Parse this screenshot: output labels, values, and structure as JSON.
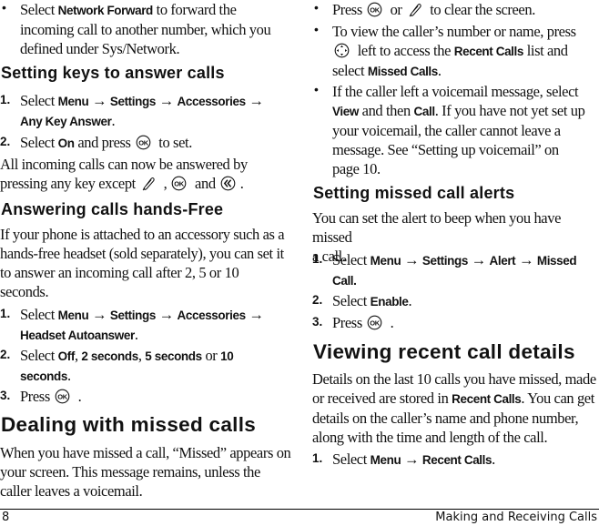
{
  "left": {
    "bullet_network": {
      "pre": "Select ",
      "bold": "Network Forward",
      "post1": " to forward the",
      "line2": "incoming call to another number, which you",
      "line3": "defined under Sys/Network."
    },
    "h_setting_keys": "Setting keys to answer calls",
    "sk_step1": {
      "num": "1.",
      "pre": "Select ",
      "menu": "Menu",
      "arrow": "→",
      "settings": "Settings",
      "accessories": "Accessories",
      "line2": "Any Key Answer",
      "end": "."
    },
    "sk_step2": {
      "num": "2.",
      "pre": "Select ",
      "on": "On",
      "mid": " and press",
      "post": " to set."
    },
    "sk_para": {
      "line1": "All incoming calls can now be answered by",
      "line2_pre": "pressing any key except",
      "comma": " ,",
      "and": " and",
      "end": "."
    },
    "h_hands_free": "Answering calls hands-Free",
    "hf_para": [
      "If your phone is attached to an accessory such as a",
      "hands-free headset (sold separately), you can set it",
      "to answer an incoming call after 2, 5 or 10",
      "seconds."
    ],
    "hf_step1": {
      "num": "1.",
      "pre": "Select ",
      "menu": "Menu",
      "arrow": "→",
      "settings": "Settings",
      "accessories": "Accessories",
      "line2": "Headset Autoanswer",
      "end": "."
    },
    "hf_step2": {
      "num": "2.",
      "pre": "Select ",
      "off": "Off",
      "comma": ", ",
      "two": "2 seconds",
      "five": "5 seconds",
      "or": " or ",
      "ten": "10",
      "line2": "seconds",
      "end": "."
    },
    "hf_step3": {
      "num": "3.",
      "pre": "Press",
      "end": " ."
    },
    "h_missed": "Dealing with missed calls",
    "missed_para": [
      "When you have missed a call, “Missed” appears on",
      "your screen. This message remains, unless the",
      "caller leaves a voicemail."
    ]
  },
  "right": {
    "b1": {
      "pre": "Press",
      "or": " or",
      "post": " to clear the screen."
    },
    "b2": {
      "line1": "To view the caller’s number or name, press",
      "line2_post": " left to access the ",
      "recent": "Recent Calls",
      "list": " list and",
      "line3_pre": "select ",
      "missed": "Missed Calls",
      "end": "."
    },
    "b3": {
      "line1": "If the caller left a voicemail message, select",
      "view": "View",
      "and_then": " and then ",
      "call": "Call",
      "line2_post": ". If you have not yet set up",
      "line3": "your voicemail, the caller cannot leave a",
      "line4": "message. See “Setting up voicemail” on",
      "line5": "page 10."
    },
    "h_alerts": "Setting missed call alerts",
    "alerts_para": [
      "You can set the alert to beep when you have missed",
      "a call."
    ],
    "al_step1": {
      "num": "1.",
      "pre": "Select ",
      "menu": "Menu",
      "arrow": "→",
      "settings": "Settings",
      "alert": "Alert",
      "missed": "Missed",
      "line2": "Call."
    },
    "al_step2": {
      "num": "2.",
      "pre": "Select ",
      "enable": "Enable",
      "end": "."
    },
    "al_step3": {
      "num": "3.",
      "pre": "Press",
      "end": " ."
    },
    "h_recent": "Viewing recent call details",
    "recent_para": {
      "line1": "Details on the last 10 calls you have missed, made",
      "line2_pre": "or received are stored in ",
      "recent": "Recent Calls",
      "line2_post": ". You can get",
      "line3": "details on the caller’s name and phone number,",
      "line4": "along with the time and length of the call."
    },
    "rc_step1": {
      "num": "1.",
      "pre": "Select ",
      "menu": "Menu",
      "arrow": "→",
      "recent": "Recent Calls",
      "end": "."
    }
  },
  "footer": {
    "page_number": "8",
    "chapter_title": "Making and Receiving Calls"
  },
  "icons": {
    "ok": "ok-key-icon",
    "clear": "clear-key-icon",
    "back": "back-key-icon",
    "nav": "nav-key-icon"
  }
}
